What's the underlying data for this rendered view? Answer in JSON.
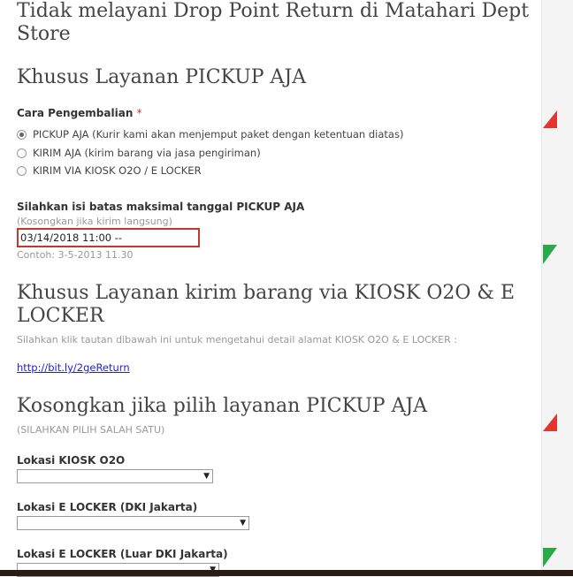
{
  "headings": {
    "drop_point": "Tidak melayani Drop Point Return di Matahari Dept Store",
    "pickup_only": "Khusus Layanan PICKUP AJA",
    "kiosk": "Khusus Layanan kirim barang via KIOSK O2O & E LOCKER",
    "empty_if_pickup": "Kosongkan jika pilih layanan PICKUP AJA"
  },
  "return_method": {
    "label": "Cara Pengembalian",
    "required_mark": "*",
    "options": [
      {
        "label": "PICKUP AJA (Kurir kami akan menjemput paket dengan ketentuan diatas)",
        "checked": true
      },
      {
        "label": "KIRIM AJA (kirim barang via jasa pengiriman)",
        "checked": false
      },
      {
        "label": "KIRIM VIA KIOSK O2O / E LOCKER",
        "checked": false
      }
    ]
  },
  "pickup_date": {
    "label": "Silahkan isi batas maksimal tanggal PICKUP AJA",
    "hint": "(Kosongkan jika kirim langsung)",
    "value": "03/14/2018 11:00 --",
    "example": "Contoh: 3-5-2013 11.30"
  },
  "kiosk_info": {
    "text": "Silahkan klik tautan dibawah ini untuk mengetahui detail alamat KIOSK O2O & E LOCKER :",
    "link": "http://bit.ly/2geReturn"
  },
  "choose_one": "(SILAHKAN PILIH SALAH SATU)",
  "selects": {
    "kiosk_location": {
      "label": "Lokasi KIOSK O2O",
      "value": ""
    },
    "elocker_jakarta": {
      "label": "Lokasi E LOCKER (DKI Jakarta)",
      "value": ""
    },
    "elocker_outside": {
      "label": "Lokasi E LOCKER (Luar DKI Jakarta)",
      "value": ""
    }
  },
  "colors": {
    "required": "#c0392b",
    "link": "#2222cc",
    "red_marker": "#e3342f",
    "green_marker": "#2aa84a"
  }
}
